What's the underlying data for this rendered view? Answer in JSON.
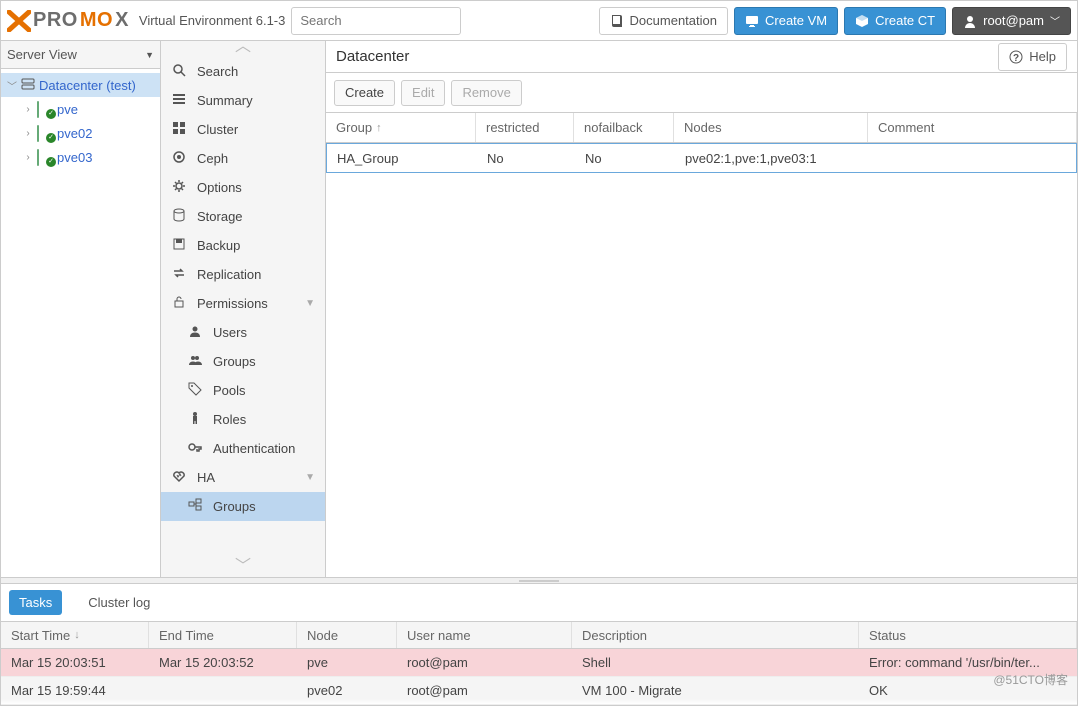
{
  "header": {
    "product_gray": "PRO",
    "product_orange": "MO",
    "env_label": "Virtual Environment 6.1-3",
    "search_placeholder": "Search",
    "doc_label": "Documentation",
    "create_vm_label": "Create VM",
    "create_ct_label": "Create CT",
    "user_label": "root@pam"
  },
  "sidebar": {
    "view_select": "Server View",
    "tree": {
      "root": "Datacenter (test)",
      "nodes": [
        "pve",
        "pve02",
        "pve03"
      ]
    }
  },
  "nav": {
    "items": [
      {
        "icon": "search",
        "label": "Search",
        "indent": false
      },
      {
        "icon": "list",
        "label": "Summary",
        "indent": false
      },
      {
        "icon": "grid",
        "label": "Cluster",
        "indent": false
      },
      {
        "icon": "ceph",
        "label": "Ceph",
        "indent": false
      },
      {
        "icon": "gear",
        "label": "Options",
        "indent": false
      },
      {
        "icon": "db",
        "label": "Storage",
        "indent": false
      },
      {
        "icon": "save",
        "label": "Backup",
        "indent": false
      },
      {
        "icon": "exchange",
        "label": "Replication",
        "indent": false
      },
      {
        "icon": "lock",
        "label": "Permissions",
        "indent": false,
        "expand": true
      },
      {
        "icon": "user",
        "label": "Users",
        "indent": true
      },
      {
        "icon": "users",
        "label": "Groups",
        "indent": true
      },
      {
        "icon": "tag",
        "label": "Pools",
        "indent": true
      },
      {
        "icon": "male",
        "label": "Roles",
        "indent": true
      },
      {
        "icon": "key",
        "label": "Authentication",
        "indent": true
      },
      {
        "icon": "heart",
        "label": "HA",
        "indent": false,
        "expand": true
      },
      {
        "icon": "object",
        "label": "Groups",
        "indent": true,
        "selected": true
      }
    ]
  },
  "content": {
    "title": "Datacenter",
    "help_label": "Help",
    "toolbar": {
      "create": "Create",
      "edit": "Edit",
      "remove": "Remove"
    },
    "columns": {
      "group": "Group",
      "restricted": "restricted",
      "nofailback": "nofailback",
      "nodes": "Nodes",
      "comment": "Comment"
    },
    "rows": [
      {
        "group": "HA_Group",
        "restricted": "No",
        "nofailback": "No",
        "nodes": "pve02:1,pve:1,pve03:1",
        "comment": ""
      }
    ]
  },
  "log": {
    "tabs": {
      "tasks": "Tasks",
      "cluster": "Cluster log"
    },
    "columns": {
      "start": "Start Time",
      "end": "End Time",
      "node": "Node",
      "user": "User name",
      "desc": "Description",
      "status": "Status"
    },
    "rows": [
      {
        "start": "Mar 15 20:03:51",
        "end": "Mar 15 20:03:52",
        "node": "pve",
        "user": "root@pam",
        "desc": "Shell",
        "status": "Error: command '/usr/bin/ter...",
        "err": true
      },
      {
        "start": "Mar 15 19:59:44",
        "end": "",
        "node": "pve02",
        "user": "root@pam",
        "desc": "VM 100 - Migrate",
        "status": "OK",
        "err": false
      }
    ]
  },
  "watermark": "@51CTO博客"
}
